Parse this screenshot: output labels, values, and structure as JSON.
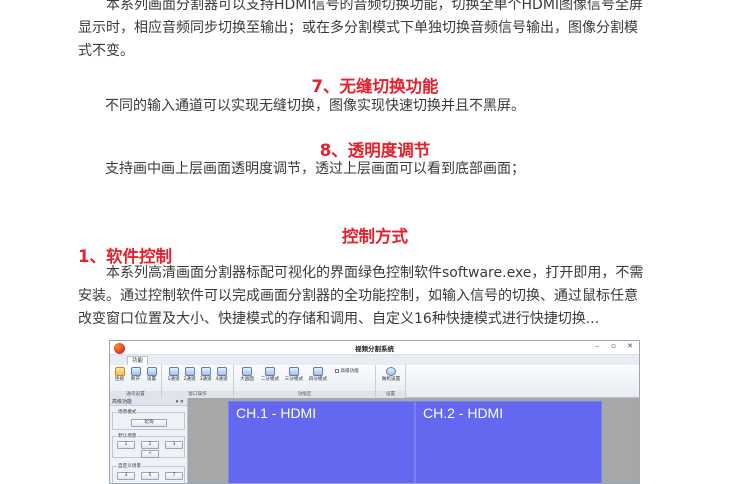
{
  "top_paragraph": {
    "line1": "本系列画面分割器可以支持HDMI信号的音频切换功能，切换全单个HDMI图像信号全屏",
    "line2": "显示时，相应音频同步切换至输出；或在多分割模式下单独切换音频信号输出，图像分割模",
    "line3": "式不变。"
  },
  "section7": {
    "heading": "7、无缝切换功能",
    "body": "不同的输入通道可以实现无缝切换，图像实现快速切换并且不黑屏。"
  },
  "section8": {
    "heading": "8、透明度调节",
    "body": "支持画中画上层画面透明度调节，透过上层画面可以看到底部画面；"
  },
  "control": {
    "heading": "控制方式",
    "sub_heading": "1、软件控制",
    "line1": "本系列高清画面分割器标配可视化的界面绿色控制软件software.exe，打开即用，不需",
    "line2": "安装。通过控制软件可以完成画面分割器的全功能控制，如输入信号的切换、通过鼠标任意",
    "line3": "改变窗口位置及大小、快捷模式的存储和调用、自定义16种快捷模式进行快捷切换..."
  },
  "software": {
    "window_title": "视频分割系统",
    "controls": {
      "minimize": "–",
      "maximize": "▫",
      "close": "✕"
    },
    "tab": "功能",
    "groups": [
      {
        "caption": "通讯设置",
        "buttons": [
          "连接",
          "断开",
          "设置"
        ]
      },
      {
        "caption": "窗口操作",
        "buttons": [
          "1通道",
          "2通道",
          "3通道",
          "4通道"
        ]
      },
      {
        "caption": "功能区",
        "buttons": [
          "大画面",
          "二分模式",
          "三分模式",
          "四分模式"
        ],
        "extra": "高级功能"
      },
      {
        "caption": "设置",
        "buttons": [
          "做机设置"
        ]
      }
    ],
    "left_panel": {
      "title": "高级功能",
      "pin": "▾ ✕",
      "section1": {
        "label": "场景模式",
        "button": "轮询"
      },
      "section2": {
        "label": "默认场景",
        "buttons": [
          "1",
          "2",
          "3",
          "<"
        ]
      },
      "section3": {
        "label": "自定义场景",
        "buttons": [
          "3",
          "5",
          "7"
        ]
      }
    },
    "channels": [
      "CH.1 - HDMI",
      "CH.2 - HDMI"
    ]
  }
}
